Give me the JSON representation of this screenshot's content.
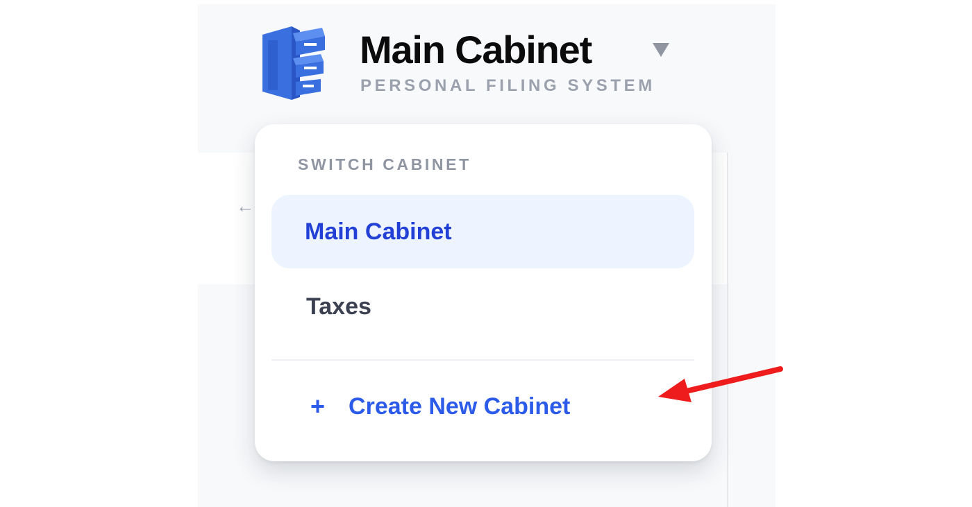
{
  "header": {
    "cabinet_name": "Main Cabinet",
    "subtitle": "PERSONAL FILING SYSTEM",
    "logo_icon": "filing-cabinet-icon",
    "caret_icon": "caret-down-icon"
  },
  "background": {
    "back_icon": "←"
  },
  "dropdown": {
    "header": "SWITCH CABINET",
    "options": [
      {
        "label": "Main Cabinet",
        "selected": true
      },
      {
        "label": "Taxes",
        "selected": false
      }
    ],
    "create": {
      "icon": "+",
      "label": "Create New Cabinet"
    }
  },
  "colors": {
    "accent": "#2b5be8",
    "selected_text": "#2340d6",
    "selected_bg": "#edf4ff",
    "logo_blue": "#3a6fe0",
    "annotation_red": "#ee1c1c"
  }
}
